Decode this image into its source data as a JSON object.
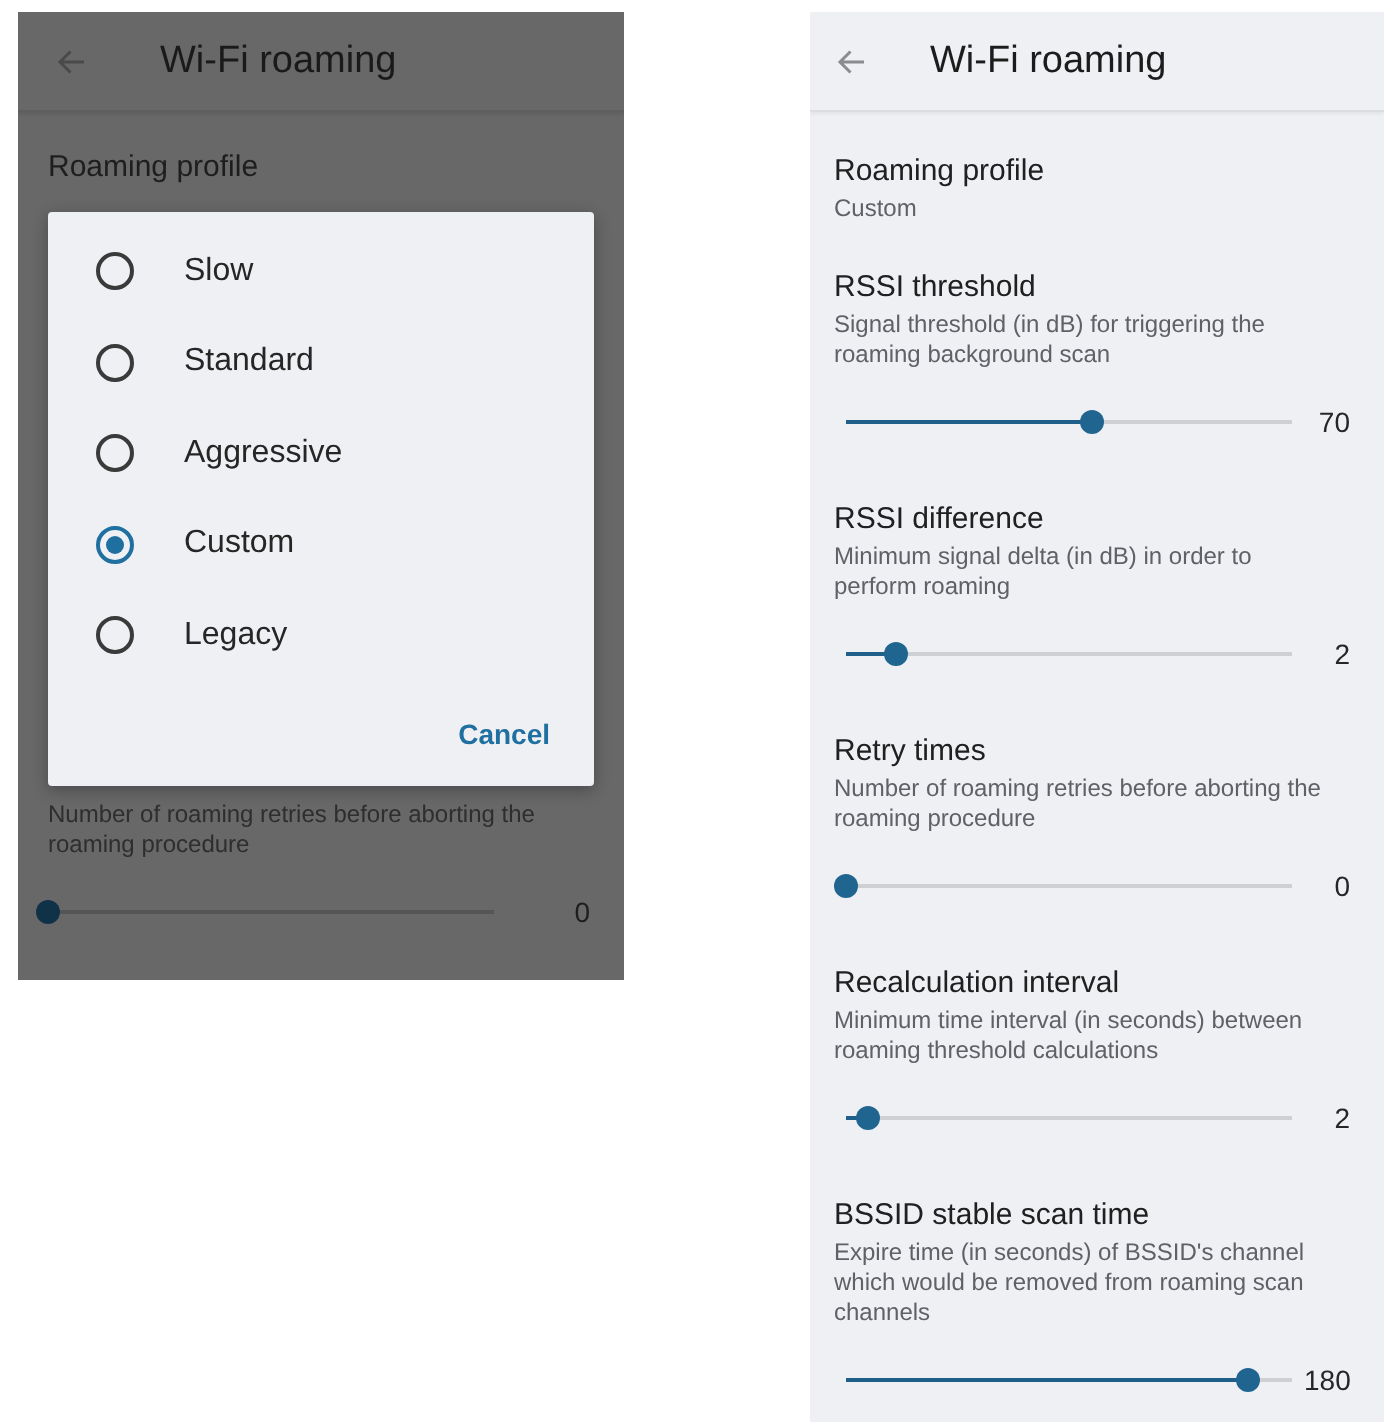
{
  "left_screen": {
    "header": {
      "title": "Wi-Fi roaming"
    },
    "profile": {
      "title": "Roaming profile"
    },
    "retry": {
      "summary": "Number of roaming retries before aborting the roaming procedure",
      "level": 0,
      "reading": "0"
    },
    "dialog": {
      "options": [
        {
          "label": "Slow",
          "selected": false
        },
        {
          "label": "Standard",
          "selected": false
        },
        {
          "label": "Aggressive",
          "selected": false
        },
        {
          "label": "Custom",
          "selected": true
        },
        {
          "label": "Legacy",
          "selected": false
        }
      ],
      "button": "Cancel"
    }
  },
  "right_screen": {
    "header": {
      "title": "Wi-Fi roaming"
    },
    "profile": {
      "title": "Roaming profile",
      "value": "Custom"
    },
    "settings": [
      {
        "title": "RSSI threshold",
        "summary": "Signal threshold (in dB) for triggering the roaming background scan",
        "level": 0.55,
        "reading": "70"
      },
      {
        "title": "RSSI difference",
        "summary": "Minimum signal delta (in dB) in order to perform roaming",
        "level": 0.11,
        "reading": "2"
      },
      {
        "title": "Retry times",
        "summary": "Number of roaming retries before aborting the roaming procedure",
        "level": 0,
        "reading": "0"
      },
      {
        "title": "Recalculation interval",
        "summary": "Minimum time interval (in seconds) between roaming threshold calculations",
        "level": 0.05,
        "reading": "2"
      },
      {
        "title": "BSSID stable scan time",
        "summary": "Expire time (in seconds) of BSSID's channel which would be removed from roaming scan channels",
        "level": 0.9,
        "reading": "180"
      }
    ]
  }
}
